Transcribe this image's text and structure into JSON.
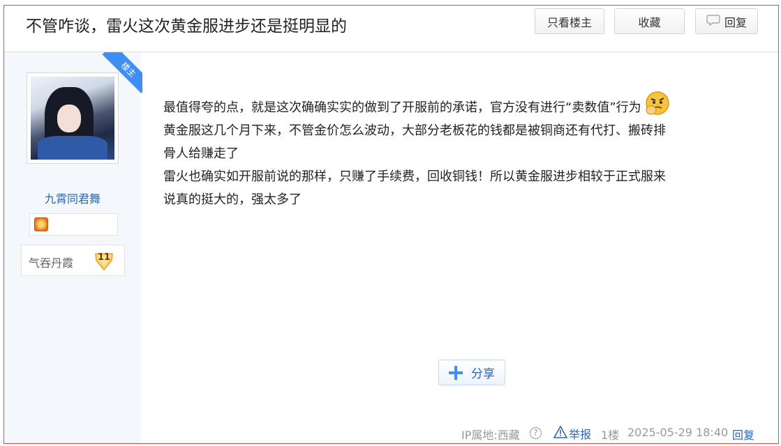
{
  "header": {
    "title": "不管咋谈，雷火这次黄金服进步还是挺明显的",
    "only_op_label": "只看楼主",
    "favorite_label": "收藏",
    "reply_label": "回复"
  },
  "user": {
    "name": "九霄同君舞",
    "op_ribbon": "楼主",
    "level_name": "气吞丹霞",
    "level": "11"
  },
  "post": {
    "lines": [
      "最值得夸的点，就是这次确确实实的做到了开服前的承诺，官方没有进行“卖数值”行为",
      "黄金服这几个月下来，不管金价怎么波动，大部分老板花的钱都是被铜商还有代打、搬砖排",
      "骨人给赚走了",
      "雷火也确实如开服前说的那样，只赚了手续费，回收铜钱！所以黄金服进步相较于正式服来",
      "说真的挺大的，强太多了"
    ],
    "share_label": "分享"
  },
  "meta": {
    "ip": "IP属地:西藏",
    "report_label": "举报",
    "floor": "1楼",
    "time": "2025-05-29 18:40",
    "reply_label": "回复"
  },
  "colors": {
    "frame": "#e8473f",
    "link": "#2d64b3",
    "accent": "#3e8ef7",
    "sidebar_bg": "#f4f7fc"
  }
}
